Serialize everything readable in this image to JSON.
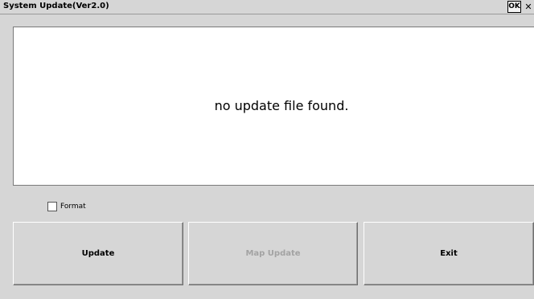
{
  "window": {
    "title": "System Update(Ver2.0)",
    "ok_label": "OK",
    "close_label": "✕"
  },
  "message": "no update file found.",
  "format": {
    "label": "Format",
    "checked": false
  },
  "buttons": {
    "update": "Update",
    "map_update": "Map Update",
    "exit": "Exit"
  },
  "colors": {
    "background": "#d6d6d6",
    "panel": "#ffffff",
    "disabled_text": "#a3a3a3"
  }
}
